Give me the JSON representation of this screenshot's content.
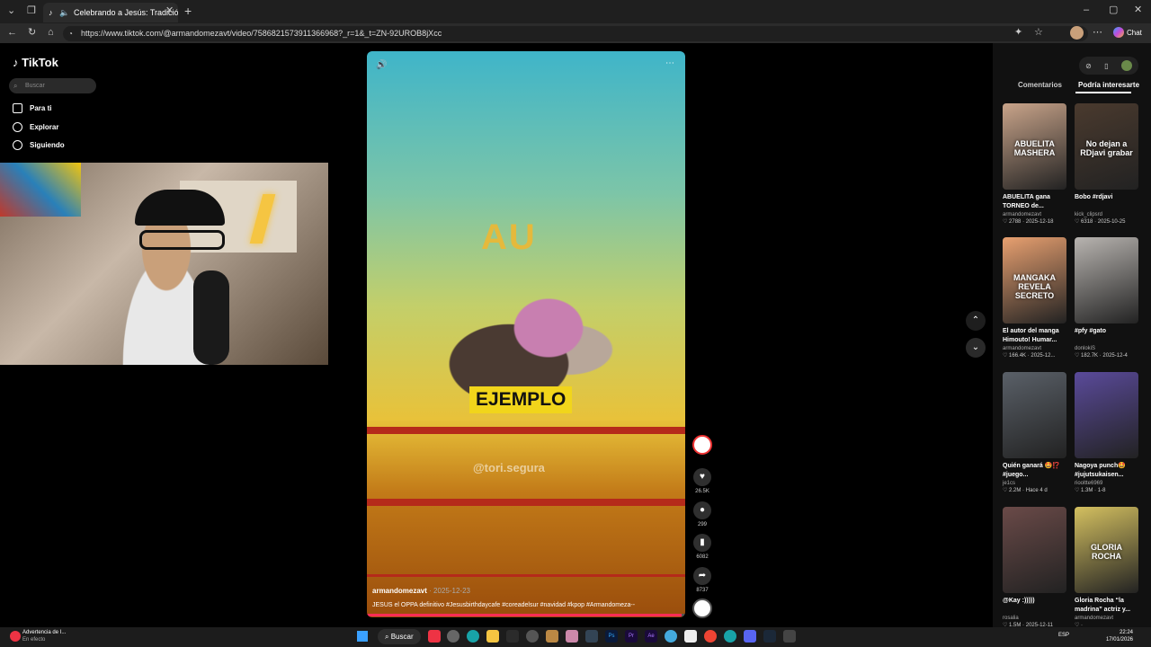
{
  "browser": {
    "tab_title": "Celebrando a Jesús: Tradición",
    "url": "https://www.tiktok.com/@armandomezavt/video/7586821573911366968?_r=1&_t=ZN-92UROB8jXcc",
    "chat_label": "Chat"
  },
  "tiktok": {
    "logo": "TikTok",
    "search_placeholder": "Buscar",
    "nav": [
      {
        "label": "Para ti",
        "icon": "home-icon"
      },
      {
        "label": "Explorar",
        "icon": "compass-icon"
      },
      {
        "label": "Siguiendo",
        "icon": "user-icon"
      }
    ]
  },
  "video": {
    "overlay_title": "AU",
    "overlay_label": "EJEMPLO",
    "watermark": "@tori.segura",
    "author": "armandomezavt",
    "date": "2025-12-23",
    "caption": "JESUS el OPPA definitivo #Jesusbirthdaycafe #coreadelsur #navidad #kpop #Armandomeza--",
    "progress": 0.99
  },
  "actions": {
    "likes": "26.5K",
    "comments": "299",
    "saves": "6082",
    "shares": "8737"
  },
  "panel": {
    "tabs": [
      "Comentarios",
      "Podría interesarte"
    ],
    "cards": [
      {
        "title": "ABUELITA gana TORNEO de...",
        "author": "armandomezavt",
        "likes": "2788",
        "date": "2025-12-18",
        "thumb_text": "ABUELITA MASHERA",
        "color": "#c9a48a"
      },
      {
        "title": "Bobo #rdjavi",
        "author": "kick_clipsrd",
        "likes": "6318",
        "date": "2025-10-25",
        "thumb_text": "No dejan a RDjavi grabar",
        "color": "#4a3a2e"
      },
      {
        "title": "El autor del manga Himouto! Humar...",
        "author": "armandomezavt",
        "likes": "166.4K",
        "date": "2025-12...",
        "thumb_text": "MANGAKA REVELA SECRETO",
        "color": "#e8a070"
      },
      {
        "title": "#pfy #gato",
        "author": "donlokiS",
        "likes": "182.7K",
        "date": "2025-12-4",
        "thumb_text": "",
        "color": "#b8b4b0"
      },
      {
        "title": "Quién ganará 🤩⁉️ #juego...",
        "author": "je1cs",
        "likes": "2.2M",
        "date": "Hace 4 d",
        "thumb_text": "",
        "color": "#5a6068"
      },
      {
        "title": "Nagoya punch🤩 #jujutsukaisen...",
        "author": "riooltte6969",
        "likes": "1.3M",
        "date": "1-8",
        "thumb_text": "",
        "color": "#5a4a9a"
      },
      {
        "title": "@Kay :)))))",
        "author": "rosalia",
        "likes": "1.5M",
        "date": "2025-12-11",
        "thumb_text": "",
        "color": "#6a4a48"
      },
      {
        "title": "Gloria Rocha “la madrina” actriz y...",
        "author": "armandomezavt",
        "likes": "",
        "date": "",
        "thumb_text": "GLORIA ROCHA",
        "color": "#d4c060"
      }
    ]
  },
  "taskbar": {
    "warning_title": "Advertencia de I...",
    "warning_sub": "En efecto",
    "search_label": "Buscar",
    "lang": "ESP",
    "time": "22:24",
    "date": "17/01/2026"
  }
}
